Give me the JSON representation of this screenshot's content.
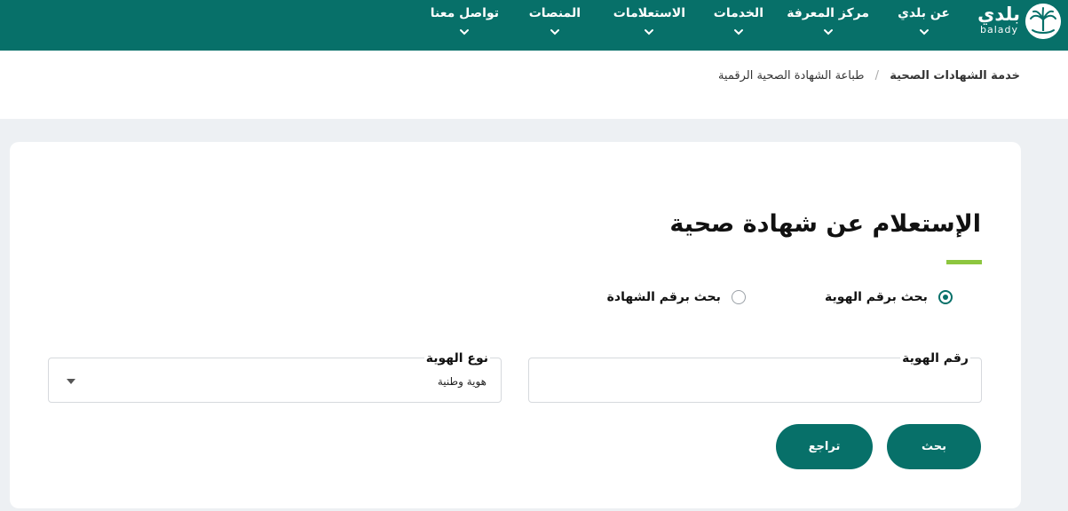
{
  "brand": {
    "name_ar": "بلدي",
    "name_en": "balady",
    "color": "#077069"
  },
  "nav": [
    {
      "label": "عن بلدي"
    },
    {
      "label": "مركز المعرفة"
    },
    {
      "label": "الخدمات"
    },
    {
      "label": "الاستعلامات"
    },
    {
      "label": "المنصات"
    },
    {
      "label": "تواصل معنا"
    }
  ],
  "icons": {
    "nav_dropdown": "chevron-down-icon",
    "select_dropdown": "caret-down-icon",
    "logo": "palm-emblem-icon"
  },
  "breadcrumb": {
    "parent": "خدمة الشهادات الصحية",
    "separator": "/",
    "current": "طباعة الشهادة الصحية الرقمية"
  },
  "page": {
    "title": "الإستعلام عن شهادة صحية",
    "accent_color": "#8dc63f"
  },
  "search_mode": {
    "options": [
      {
        "label": "بحث برقم الهوية",
        "selected": true
      },
      {
        "label": "بحث برقم الشهادة",
        "selected": false
      }
    ]
  },
  "form": {
    "id_number": {
      "label": "رقم الهوية",
      "value": ""
    },
    "id_type": {
      "label": "نوع الهوية",
      "selected": "هوية وطنية"
    }
  },
  "buttons": {
    "search": "بحث",
    "back": "تراجع"
  }
}
